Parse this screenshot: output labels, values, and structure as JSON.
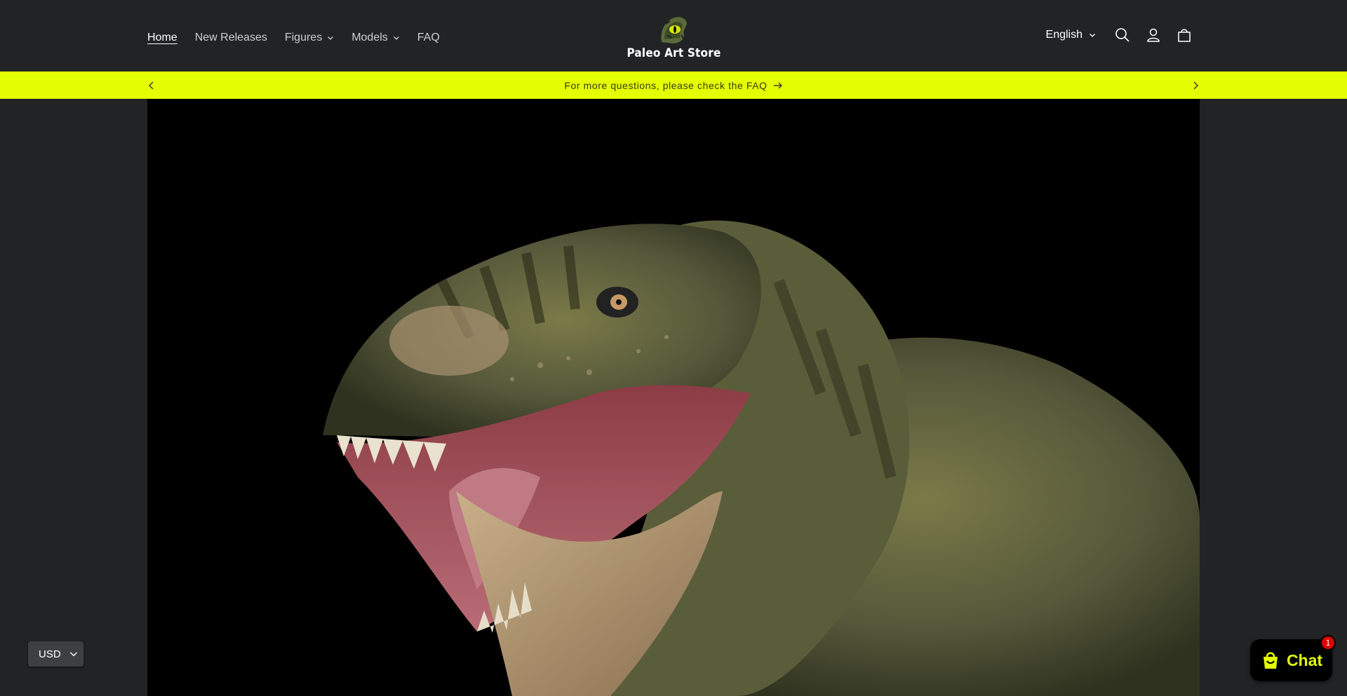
{
  "header": {
    "nav": [
      {
        "label": "Home",
        "active": true,
        "dropdown": false
      },
      {
        "label": "New Releases",
        "dropdown": false
      },
      {
        "label": "Figures",
        "dropdown": true
      },
      {
        "label": "Models",
        "dropdown": true
      },
      {
        "label": "FAQ",
        "dropdown": false
      }
    ],
    "logo_text": "Paleo Art Store",
    "language": "English",
    "icons": [
      "search-icon",
      "account-icon",
      "cart-icon"
    ]
  },
  "announcement": {
    "text": "For more questions, please check the FAQ",
    "background": "#e3ff02"
  },
  "currency": {
    "value": "USD"
  },
  "chat": {
    "label": "Chat",
    "badge": "1",
    "accent": "#e3ff02"
  }
}
